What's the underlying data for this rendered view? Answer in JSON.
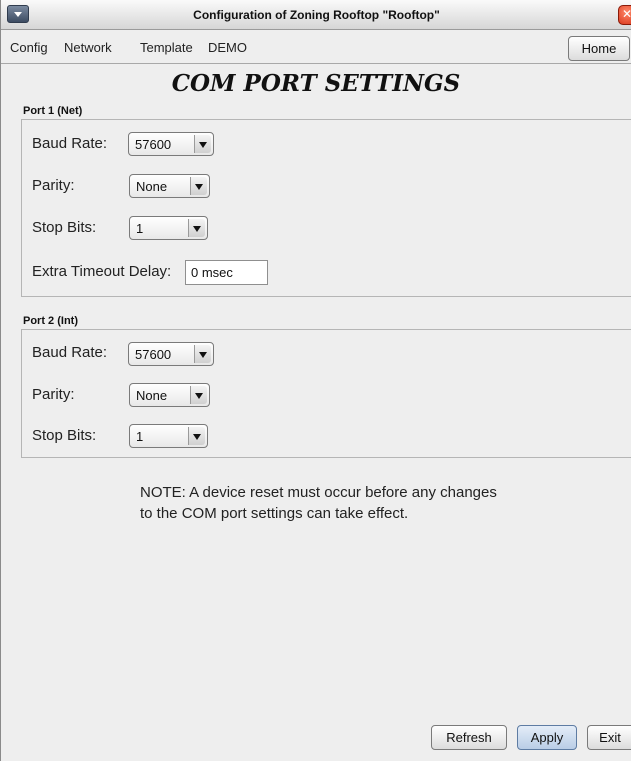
{
  "window": {
    "title": "Configuration of Zoning Rooftop \"Rooftop\""
  },
  "menu": {
    "items": [
      "Config",
      "Network",
      "Template",
      "DEMO"
    ],
    "home_label": "Home"
  },
  "page": {
    "title": "COM PORT SETTINGS"
  },
  "port1": {
    "label": "Port 1 (Net)",
    "baud_label": "Baud Rate:",
    "baud_value": "57600",
    "parity_label": "Parity:",
    "parity_value": "None",
    "stop_label": "Stop Bits:",
    "stop_value": "1",
    "timeout_label": "Extra Timeout Delay:",
    "timeout_value": "0 msec"
  },
  "port2": {
    "label": "Port 2 (Int)",
    "baud_label": "Baud Rate:",
    "baud_value": "57600",
    "parity_label": "Parity:",
    "parity_value": "None",
    "stop_label": "Stop Bits:",
    "stop_value": "1"
  },
  "note": {
    "line1": "NOTE: A device reset must occur before any changes",
    "line2": "to the COM port settings can take effect."
  },
  "buttons": {
    "refresh": "Refresh",
    "apply": "Apply",
    "exit": "Exit"
  },
  "icons": {
    "window_menu": "chevron-down-icon",
    "close": "close-icon",
    "dropdown": "chevron-down-icon"
  }
}
